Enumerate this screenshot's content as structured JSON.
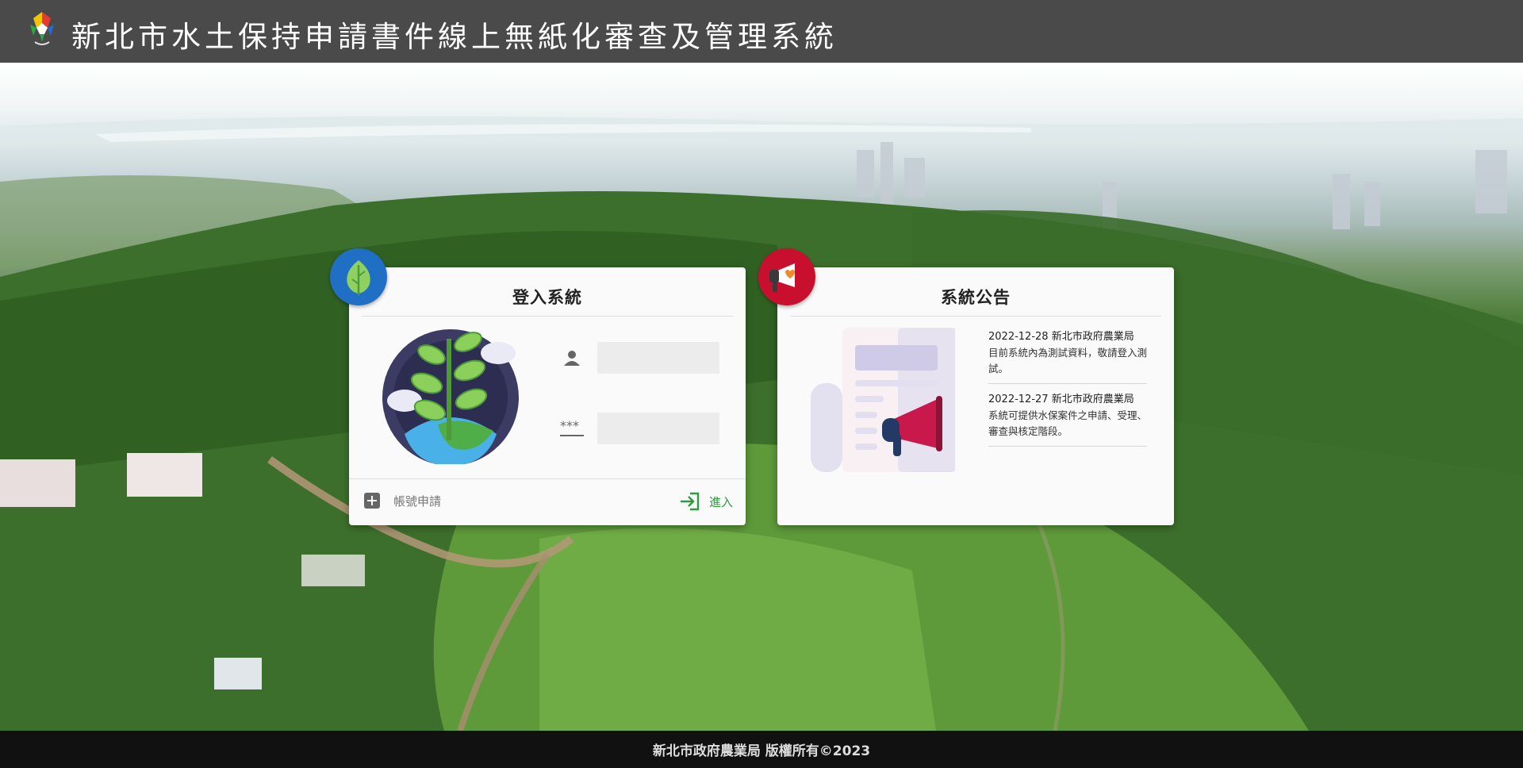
{
  "header": {
    "title": "新北市水土保持申請書件線上無紙化審查及管理系統",
    "logo_icon": "new-taipei-city-logo-icon"
  },
  "login": {
    "title": "登入系統",
    "badge_icon": "leaf-icon",
    "illustration": "plant-globe-illustration",
    "username_icon": "user-icon",
    "username_value": "",
    "password_icon": "password-icon",
    "password_value": "",
    "apply_icon": "plus-square-icon",
    "apply_label": "帳號申請",
    "enter_icon": "sign-in-icon",
    "enter_label": "進入"
  },
  "notice": {
    "title": "系統公告",
    "badge_icon": "megaphone-icon",
    "illustration": "newspaper-megaphone-illustration",
    "items": [
      {
        "date": "2022-12-28",
        "org": "新北市政府農業局",
        "text": "目前系統內為測試資料，敬請登入測試。"
      },
      {
        "date": "2022-12-27",
        "org": "新北市政府農業局",
        "text": "系統可提供水保案件之申請、受理、審查與核定階段。"
      }
    ]
  },
  "footer": {
    "text": "新北市政府農業局 版權所有©2023"
  },
  "colors": {
    "header_bg": "#4a4a4a",
    "footer_bg": "#111111",
    "login_badge": "#1f6fc4",
    "notice_badge": "#c8102e",
    "enter_green": "#2e9b3f"
  }
}
